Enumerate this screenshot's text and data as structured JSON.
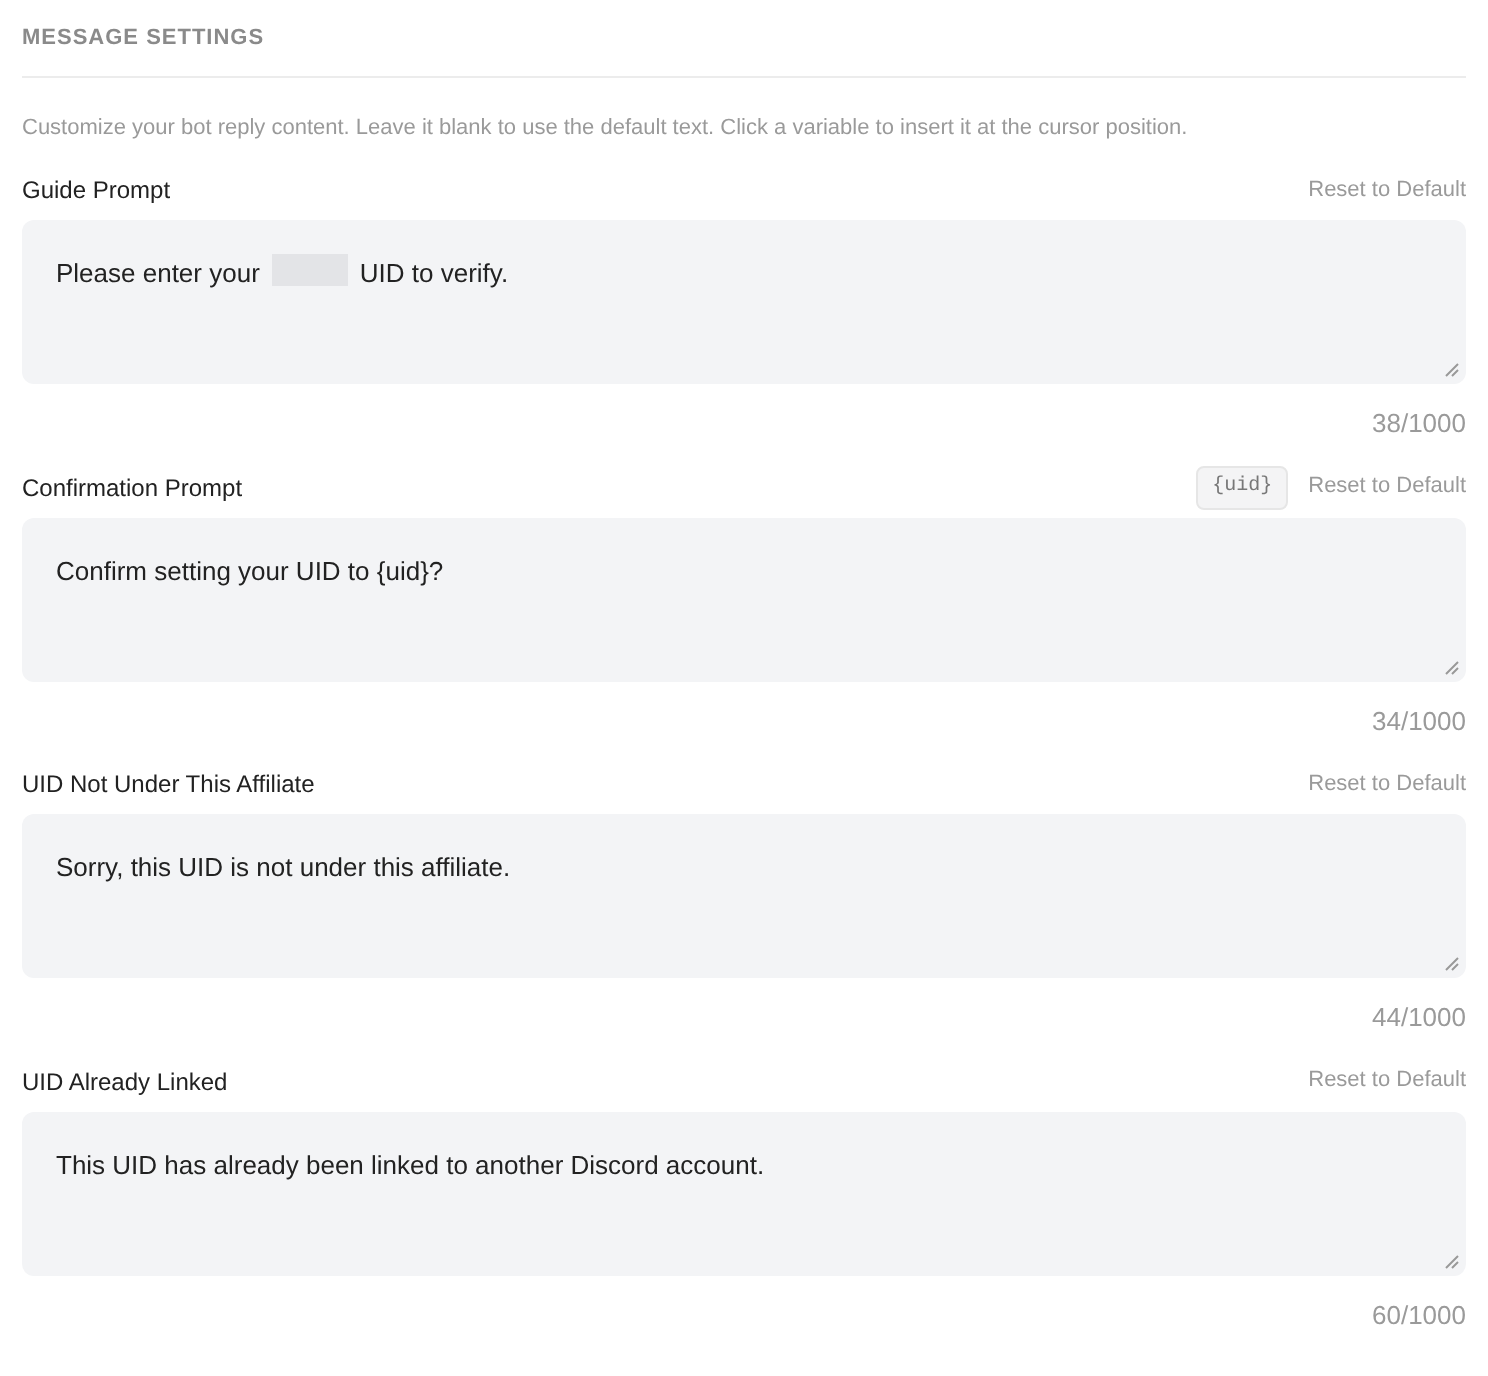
{
  "section_title": "MESSAGE SETTINGS",
  "description": "Customize your bot reply content. Leave it blank to use the default text. Click a variable to insert it at the cursor position.",
  "prompts": [
    {
      "label": "Guide Prompt",
      "reset": "Reset to Default",
      "value": [
        {
          "kind": "text",
          "text": "Please enter your"
        },
        {
          "kind": "redacted"
        },
        {
          "kind": "text",
          "text": "UID to verify."
        }
      ],
      "count": "38/1000"
    },
    {
      "label": "Confirmation Prompt",
      "variables": [
        "{uid}"
      ],
      "reset": "Reset to Default",
      "value": [
        {
          "kind": "text",
          "text": "Confirm setting your UID to {uid}?"
        }
      ],
      "count": "34/1000"
    },
    {
      "label": "UID Not Under This Affiliate",
      "reset": "Reset to Default",
      "value": [
        {
          "kind": "text",
          "text": "Sorry, this UID is not under this affiliate."
        }
      ],
      "count": "44/1000"
    },
    {
      "label": "UID Already Linked",
      "reset": "Reset to Default",
      "value": [
        {
          "kind": "text",
          "text": "This UID has already been linked to another Discord account."
        }
      ],
      "count": "60/1000"
    }
  ]
}
